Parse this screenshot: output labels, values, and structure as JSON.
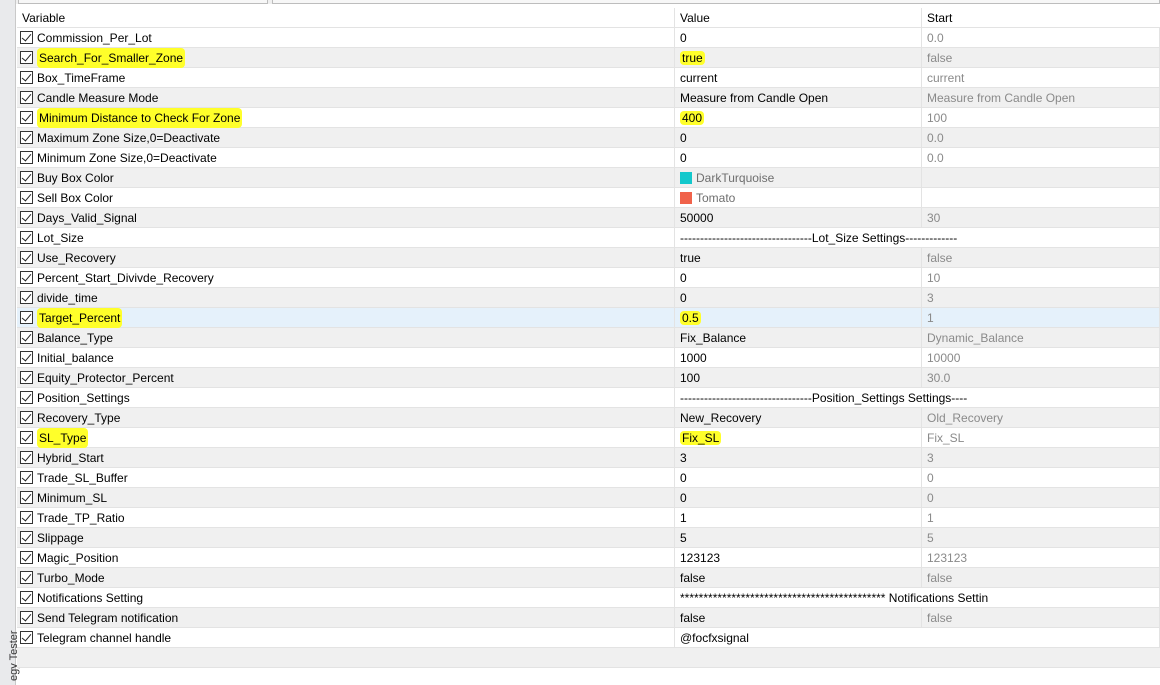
{
  "window": {
    "side_tab_label": "egy Tester"
  },
  "table": {
    "headers": {
      "variable": "Variable",
      "value": "Value",
      "start": "Start"
    },
    "rows": [
      {
        "variable": "Commission_Per_Lot",
        "value": "0",
        "start": "0.0"
      },
      {
        "variable": "Search_For_Smaller_Zone",
        "value": "true",
        "start": "false"
      },
      {
        "variable": "Box_TimeFrame",
        "value": "current",
        "start": "current"
      },
      {
        "variable": "Candle Measure Mode",
        "value": "Measure from Candle Open",
        "start": "Measure from Candle Open"
      },
      {
        "variable": "Minimum Distance to Check For Zone",
        "value": "400",
        "start": "100"
      },
      {
        "variable": "Maximum Zone Size,0=Deactivate",
        "value": "0",
        "start": "0.0"
      },
      {
        "variable": "Minimum Zone Size,0=Deactivate",
        "value": "0",
        "start": "0.0"
      },
      {
        "variable": "Buy Box Color",
        "value": "DarkTurquoise",
        "start": ""
      },
      {
        "variable": "Sell Box Color",
        "value": "Tomato",
        "start": ""
      },
      {
        "variable": "Days_Valid_Signal",
        "value": "50000",
        "start": "30"
      },
      {
        "variable": "Lot_Size",
        "value": "---------------------------------Lot_Size Settings-------------",
        "start": ""
      },
      {
        "variable": "Use_Recovery",
        "value": "true",
        "start": "false"
      },
      {
        "variable": "Percent_Start_Divivde_Recovery",
        "value": "0",
        "start": "10"
      },
      {
        "variable": "divide_time",
        "value": "0",
        "start": "3"
      },
      {
        "variable": "Target_Percent",
        "value": "0.5",
        "start": "1"
      },
      {
        "variable": "Balance_Type",
        "value": "Fix_Balance",
        "start": "Dynamic_Balance"
      },
      {
        "variable": "Initial_balance",
        "value": "1000",
        "start": "10000"
      },
      {
        "variable": "Equity_Protector_Percent",
        "value": "100",
        "start": "30.0"
      },
      {
        "variable": "Position_Settings",
        "value": "---------------------------------Position_Settings Settings----",
        "start": ""
      },
      {
        "variable": "Recovery_Type",
        "value": "New_Recovery",
        "start": "Old_Recovery"
      },
      {
        "variable": "SL_Type",
        "value": "Fix_SL",
        "start": "Fix_SL"
      },
      {
        "variable": "Hybrid_Start",
        "value": "3",
        "start": "3"
      },
      {
        "variable": "Trade_SL_Buffer",
        "value": "0",
        "start": "0"
      },
      {
        "variable": "Minimum_SL",
        "value": "0",
        "start": "0"
      },
      {
        "variable": "Trade_TP_Ratio",
        "value": "1",
        "start": "1"
      },
      {
        "variable": "Slippage",
        "value": "5",
        "start": "5"
      },
      {
        "variable": "Magic_Position",
        "value": "123123",
        "start": "123123"
      },
      {
        "variable": "Turbo_Mode",
        "value": "false",
        "start": "false"
      },
      {
        "variable": "Notifications Setting",
        "value": "******************************************** Notifications Settin",
        "start": ""
      },
      {
        "variable": "Send Telegram notification",
        "value": "false",
        "start": "false"
      },
      {
        "variable": "Telegram channel handle",
        "value": "@focfxsignal",
        "start": ""
      }
    ]
  },
  "colors": {
    "highlight": "#ffff2a",
    "dark_turquoise": "#13c8cc",
    "tomato": "#f0624a",
    "selected_row": "#e5f1fb"
  }
}
